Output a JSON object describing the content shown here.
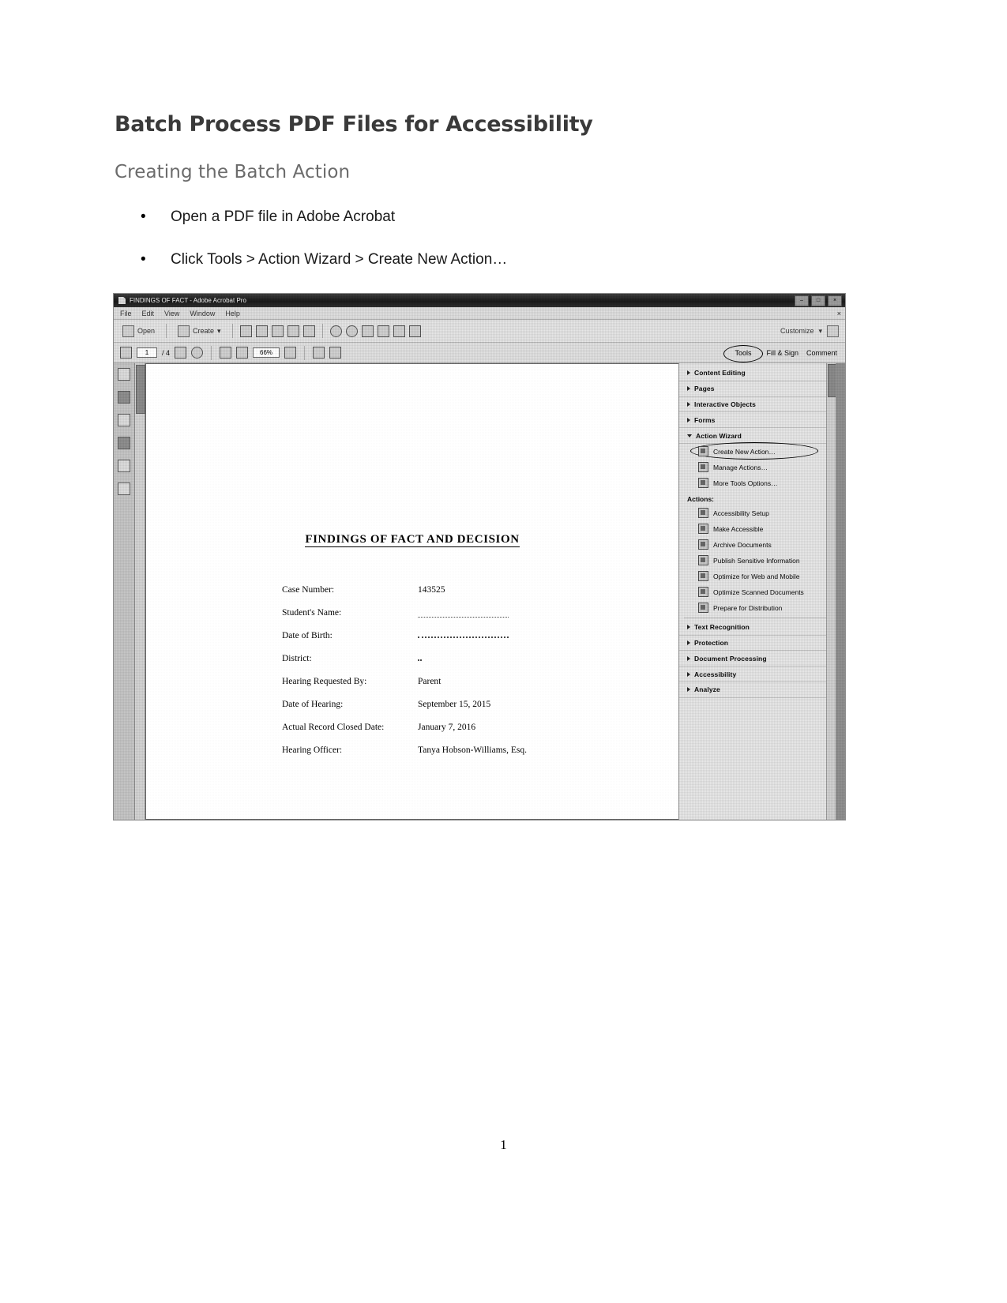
{
  "document": {
    "title": "Batch Process PDF Files for Accessibility",
    "subtitle": "Creating the Batch Action",
    "bullets": [
      "Open a PDF file in Adobe Acrobat",
      "Click Tools > Action Wizard > Create New Action…"
    ],
    "page_number": "1"
  },
  "screenshot": {
    "titlebar": {
      "text": "FINDINGS OF FACT - Adobe Acrobat Pro",
      "minimize": "–",
      "maximize": "□",
      "close": "×"
    },
    "menubar": {
      "items": [
        "File",
        "Edit",
        "View",
        "Window",
        "Help"
      ],
      "close_doc": "×"
    },
    "toolbar": {
      "open_label": "Open",
      "create_label": "Create",
      "create_caret": "▾",
      "customize_label": "Customize",
      "customize_caret": "▾",
      "icons": [
        "open-folder-icon",
        "create-icon",
        "save-icon",
        "email-icon",
        "print-icon",
        "comment-icon",
        "highlight-icon",
        "sign-icon",
        "stamp-icon",
        "attach-icon",
        "secure-icon",
        "export-icon",
        "more-icon"
      ]
    },
    "navbar": {
      "page_value": "1",
      "page_total": "/ 4",
      "zoom_value": "66%",
      "tabs": [
        "Tools",
        "Fill & Sign",
        "Comment"
      ],
      "active_tab": "Tools"
    },
    "left_rail": {
      "icons": [
        "thumbnails-icon",
        "bookmarks-icon",
        "pages-icon",
        "attachments-icon",
        "signatures-icon",
        "layers-icon"
      ]
    },
    "pdf_page": {
      "heading": "FINDINGS OF FACT AND DECISION",
      "fields": [
        {
          "label": "Case Number:",
          "value": "143525",
          "redacted": "none"
        },
        {
          "label": "Student's Name:",
          "value": "",
          "redacted": "line"
        },
        {
          "label": "Date of Birth:",
          "value": "",
          "redacted": "dots"
        },
        {
          "label": "District:",
          "value": "",
          "redacted": "tiny"
        },
        {
          "label": "Hearing Requested By:",
          "value": "Parent",
          "redacted": "none"
        },
        {
          "label": "Date of Hearing:",
          "value": "September 15, 2015",
          "redacted": "none"
        },
        {
          "label": "Actual Record Closed Date:",
          "value": "January 7, 2016",
          "redacted": "none"
        },
        {
          "label": "Hearing Officer:",
          "value": "Tanya Hobson-Williams, Esq.",
          "redacted": "none"
        }
      ]
    },
    "tools_panel": {
      "sections": [
        {
          "label": "Content Editing",
          "expanded": false
        },
        {
          "label": "Pages",
          "expanded": false
        },
        {
          "label": "Interactive Objects",
          "expanded": false
        },
        {
          "label": "Forms",
          "expanded": false
        },
        {
          "label": "Action Wizard",
          "expanded": true
        }
      ],
      "wizard_items": [
        {
          "label": "Create New Action…",
          "highlighted": true
        },
        {
          "label": "Manage Actions…",
          "highlighted": false
        },
        {
          "label": "More Tools Options…",
          "highlighted": false
        }
      ],
      "actions_group_label": "Actions:",
      "actions": [
        "Accessibility Setup",
        "Make Accessible",
        "Archive Documents",
        "Publish Sensitive Information",
        "Optimize for Web and Mobile",
        "Optimize Scanned Documents",
        "Prepare for Distribution"
      ],
      "bottom_sections": [
        "Text Recognition",
        "Protection",
        "Document Processing",
        "Accessibility",
        "Analyze"
      ]
    }
  },
  "colors": {
    "heading": "#3a3a3a",
    "subheading": "#6b6b6b",
    "chrome": "#d7d7d7",
    "panel": "#d9d9d9",
    "workarea": "#8f8f8f"
  }
}
